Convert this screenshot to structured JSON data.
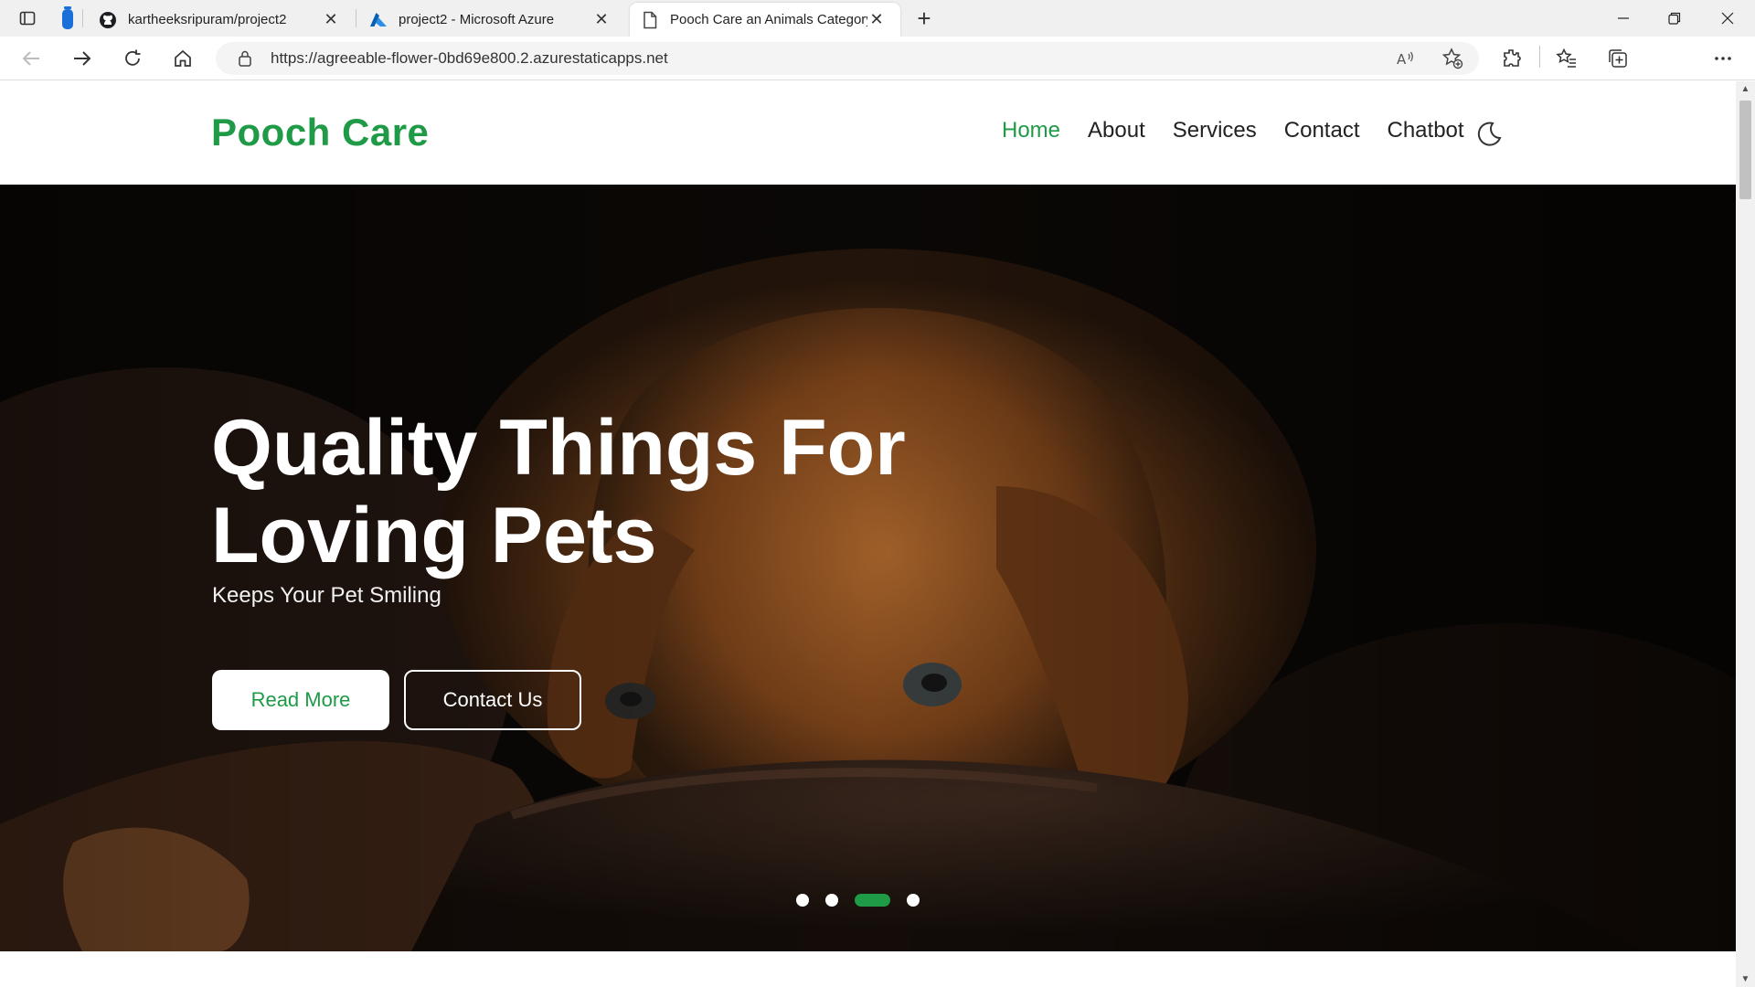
{
  "browser": {
    "tabs": [
      {
        "title": "kartheeksripuram/project2",
        "favicon": "github-icon",
        "active": false
      },
      {
        "title": "project2 - Microsoft Azure",
        "favicon": "azure-icon",
        "active": false
      },
      {
        "title": "Pooch Care an Animals Category",
        "favicon": "page-icon",
        "active": true
      }
    ],
    "url": "https://agreeable-flower-0bd69e800.2.azurestaticapps.net",
    "read_aloud_label": "A⁾"
  },
  "site": {
    "brand": "Pooch Care",
    "nav": [
      "Home",
      "About",
      "Services",
      "Contact",
      "Chatbot"
    ],
    "active_nav": "Home",
    "theme_toggle_icon": "moon-icon"
  },
  "hero": {
    "title_line1": "Quality Things For",
    "title_line2": "Loving Pets",
    "subtitle": "Keeps Your Pet Smiling",
    "primary_button": "Read More",
    "secondary_button": "Contact Us",
    "slides": 4,
    "active_slide": 3
  },
  "colors": {
    "brand_green": "#1f9a46",
    "hero_bg": "#0a0807"
  }
}
